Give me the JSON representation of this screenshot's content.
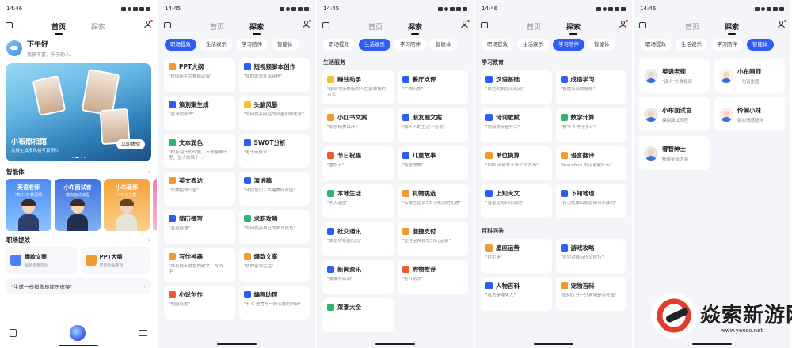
{
  "colors": {
    "accent": "#2d5cf6",
    "card": "#ffffff",
    "bg": "#f4f5f8"
  },
  "panels": [
    {
      "time": "14:46",
      "tabs": [
        "首页",
        "探索"
      ],
      "active_tab": 0,
      "greeting": {
        "title": "下午好",
        "subtitle": "我很丰富，乐于助人。"
      },
      "banner": {
        "title": "小布照相馆",
        "subtitle": "免费生成多风格写真照片",
        "button": "立即体验"
      },
      "agents_title": "智能体",
      "agents": [
        {
          "name": "英语老师",
          "desc": "\"真人\"外教视频"
        },
        {
          "name": "小布面试官",
          "desc": "模拟面试流程"
        },
        {
          "name": "小布画师",
          "desc": "一句话生图"
        }
      ],
      "tools_title": "职场提效",
      "tools": [
        {
          "name": "爆款文案",
          "desc": "解锁流量密码"
        },
        {
          "name": "PPT大纲",
          "desc": "智能拆解要点"
        }
      ],
      "prompt": "\"生成一份销售员简历框架\""
    },
    {
      "time": "14:45",
      "tabs": [
        "首页",
        "探索"
      ],
      "active_tab": 1,
      "chips": [
        "职场提效",
        "生活娱乐",
        "学习陪伴",
        "智能体"
      ],
      "active_chip": 0,
      "cards": [
        {
          "title": "PPT大纲",
          "sub": "\"校园新手大赛启动会\"",
          "icon": "ppt-icon",
          "color": "#f29a2e"
        },
        {
          "title": "短视频脚本创作",
          "sub": "\"我的周末外出穿搭\"",
          "icon": "video-icon",
          "color": "#2d5cf6"
        },
        {
          "title": "策划案生成",
          "sub": "\"我请假条书\"",
          "icon": "plan-icon",
          "color": "#2d5cf6"
        },
        {
          "title": "头脑风暴",
          "sub": "\"如何提高网站的流量和转化率\"",
          "icon": "bulb-icon",
          "color": "#f2c12e"
        },
        {
          "title": "文本润色",
          "sub": "\"校花迎开的时候，不说春飘十里，至少前后十…\"",
          "icon": "text-icon",
          "color": "#2bb673"
        },
        {
          "title": "SWOT分析",
          "sub": "\"电子商务业\"",
          "icon": "swot-icon",
          "color": "#2d5cf6"
        },
        {
          "title": "英文表达",
          "sub": "\"失物招领公告\"",
          "icon": "english-icon",
          "color": "#f29a2e"
        },
        {
          "title": "演讲稿",
          "sub": "\"环保意识，共建美好家园\"",
          "icon": "speech-icon",
          "color": "#2d5cf6"
        },
        {
          "title": "简历撰写",
          "sub": "\"基金经理\"",
          "icon": "resume-icon",
          "color": "#2d5cf6"
        },
        {
          "title": "求职攻略",
          "sub": "\"如何提高自己的面试技巧\"",
          "icon": "job-icon",
          "color": "#2bb673"
        },
        {
          "title": "写作神器",
          "sub": "\"描写秋天景色的散文，800 字\"",
          "icon": "write-icon",
          "color": "#f29a2e"
        },
        {
          "title": "爆款文案",
          "sub": "\"我的留学生活\"",
          "icon": "hot-icon",
          "color": "#f29a2e"
        },
        {
          "title": "小说创作",
          "sub": "\"校园恋爱\"",
          "icon": "novel-icon",
          "color": "#f25a2e"
        },
        {
          "title": "编程助理",
          "sub": "\"用 C 语言写一段心脏的代码\"",
          "icon": "code-icon",
          "color": "#2d5cf6"
        }
      ]
    },
    {
      "time": "14:45",
      "tabs": [
        "首页",
        "探索"
      ],
      "active_tab": 1,
      "chips": [
        "职场提效",
        "生活娱乐",
        "学习陪伴",
        "智能体"
      ],
      "active_chip": 1,
      "section": "生活服务",
      "cards": [
        {
          "title": "赚钱助手",
          "sub": "\"适合学历较低的人在家赚钱的方式\"",
          "icon": "money-icon",
          "color": "#f2c12e"
        },
        {
          "title": "餐厅点评",
          "sub": "\"牛肉火锅\"",
          "icon": "food-icon",
          "color": "#2d5cf6"
        },
        {
          "title": "小红书文案",
          "sub": "\"原创精美耳环\"",
          "icon": "note-icon",
          "color": "#f29a2e"
        },
        {
          "title": "朋友圈文案",
          "sub": "\"成年人的生活不容易\"",
          "icon": "moments-icon",
          "color": "#2d5cf6"
        },
        {
          "title": "节日祝福",
          "sub": "\"重阳节\"",
          "icon": "festival-icon",
          "color": "#f25a2e"
        },
        {
          "title": "儿童故事",
          "sub": "\"狐假虎威\"",
          "icon": "story-icon",
          "color": "#2d5cf6"
        },
        {
          "title": "本地生活",
          "sub": "\"明天温度\"",
          "icon": "local-icon",
          "color": "#2bb673"
        },
        {
          "title": "礼物挑选",
          "sub": "\"有哪些适合3岁小女孩的礼物\"",
          "icon": "gift-icon",
          "color": "#f29a2e"
        },
        {
          "title": "社交通讯",
          "sub": "\"微信转账给妈妈\"",
          "icon": "social-icon",
          "color": "#2d5cf6"
        },
        {
          "title": "便捷支付",
          "sub": "\"支付宝帮我充30元话费\"",
          "icon": "pay-icon",
          "color": "#f29a2e"
        },
        {
          "title": "新闻资讯",
          "sub": "\"我要听新闻\"",
          "icon": "news-icon",
          "color": "#2d5cf6"
        },
        {
          "title": "购物推荐",
          "sub": "\"打开京东\"",
          "icon": "shop-icon",
          "color": "#f25a2e"
        },
        {
          "title": "菜谱大全",
          "sub": "",
          "icon": "recipe-icon",
          "color": "#2bb673"
        }
      ]
    },
    {
      "time": "14:46",
      "tabs": [
        "首页",
        "探索"
      ],
      "active_tab": 1,
      "chips": [
        "职场提效",
        "生活娱乐",
        "学习陪伴",
        "智能体"
      ],
      "active_chip": 2,
      "section": "学习教育",
      "cards": [
        {
          "title": "汉语基础",
          "sub": "\"白色的白怎么组词\"",
          "icon": "chinese-icon",
          "color": "#2d5cf6"
        },
        {
          "title": "成语学习",
          "sub": "\"稳重搞合的意思\"",
          "icon": "idiom-icon",
          "color": "#2d5cf6"
        },
        {
          "title": "诗词歌赋",
          "sub": "\"念奴娇赤壁怀古\"",
          "icon": "poem-icon",
          "color": "#2d5cf6"
        },
        {
          "title": "数学计算",
          "sub": "\"根号 4 等于多少\"",
          "icon": "math-icon",
          "color": "#2bb673"
        },
        {
          "title": "单位换算",
          "sub": "\"600 英亩等于多少平方米\"",
          "icon": "unit-icon",
          "color": "#f29a2e"
        },
        {
          "title": "语言翻译",
          "sub": "\"therefore 的汉语是什么\"",
          "icon": "translate-icon",
          "color": "#f29a2e"
        },
        {
          "title": "上知天文",
          "sub": "\"彗星是如何形成的\"",
          "icon": "astronomy-icon",
          "color": "#2d5cf6"
        },
        {
          "title": "下知地理",
          "sub": "\"青马拉雅山脉是如何形成的\"",
          "icon": "geography-icon",
          "color": "#2d5cf6"
        }
      ],
      "section2": "百科问答",
      "cards2": [
        {
          "title": "星座运势",
          "sub": "\"射手座\"",
          "icon": "zodiac-icon",
          "color": "#f29a2e"
        },
        {
          "title": "游戏攻略",
          "sub": "\"宣望对线有什么技巧\"",
          "icon": "game-icon",
          "color": "#2d5cf6"
        },
        {
          "title": "人物百科",
          "sub": "\"张杰是哪里人\"",
          "icon": "person-icon",
          "color": "#2d5cf6"
        },
        {
          "title": "宠物百科",
          "sub": "\"如何区分一只狗狗是否死掉\"",
          "icon": "pet-icon",
          "color": "#f29a2e"
        }
      ]
    },
    {
      "time": "14:46",
      "tabs": [
        "首页",
        "探索"
      ],
      "active_tab": 1,
      "chips": [
        "职场提效",
        "生活娱乐",
        "学习陪伴",
        "智能体"
      ],
      "active_chip": 3,
      "agents": [
        {
          "name": "英语老师",
          "desc": "\"真人\"外教视频",
          "color": "#3b6fd8"
        },
        {
          "name": "小布画师",
          "desc": "一句话生图",
          "color": "#f29a2e"
        },
        {
          "name": "小布面试官",
          "desc": "模拟面试流程",
          "color": "#5a6a8a"
        },
        {
          "name": "伶俐小妹",
          "desc": "贴心情感陪伴",
          "color": "#e86fa0"
        },
        {
          "name": "睿智绅士",
          "desc": "畅聊星辰大海",
          "color": "#344a7a"
        }
      ]
    }
  ],
  "watermark": {
    "brand": "焱索新游网",
    "url": "www.yenso.net"
  }
}
